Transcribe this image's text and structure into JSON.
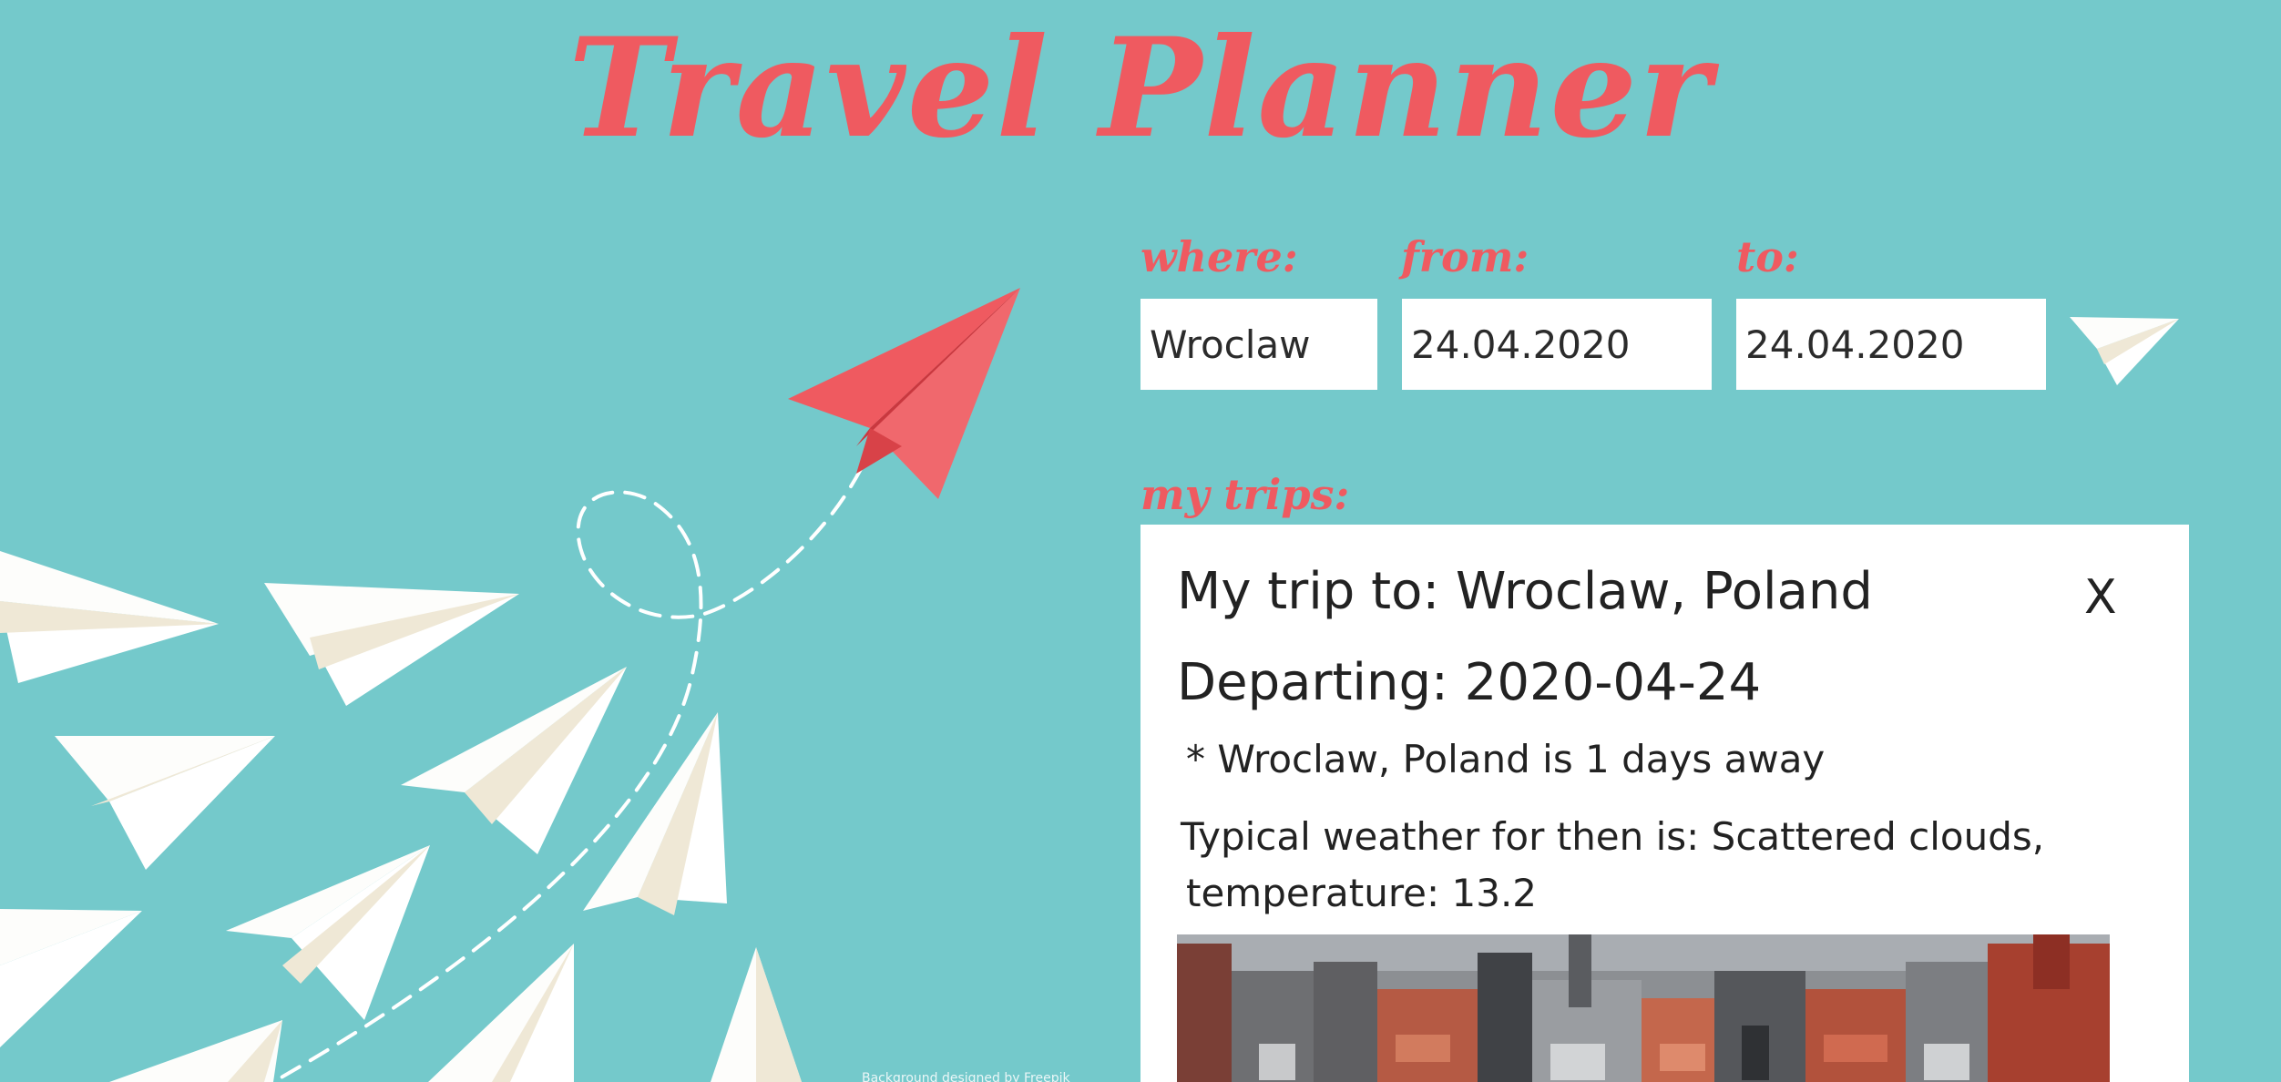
{
  "header": {
    "title": "Travel Planner"
  },
  "form": {
    "where_label": "where:",
    "where_value": "Wroclaw",
    "from_label": "from:",
    "from_value": "24.04.2020",
    "to_label": "to:",
    "to_value": "24.04.2020",
    "submit_icon": "paper-plane-icon"
  },
  "trips": {
    "label": "my trips:",
    "items": [
      {
        "heading": "My trip to: Wroclaw, Poland",
        "close_label": "X",
        "departing": "Departing: 2020-04-24",
        "countdown": "* Wroclaw, Poland is 1 days away",
        "weather_line1": "Typical weather for then is: Scattered clouds,",
        "weather_line2": "temperature: 13.2",
        "photo_icon": "city-photo-icon"
      }
    ]
  },
  "footer": {
    "credit": "Background designed by Freepik"
  },
  "colors": {
    "background": "#74c9cb",
    "accent": "#ef5a60",
    "card": "#ffffff",
    "plane_white": "#fdfdfb",
    "plane_shade": "#efe8d6"
  }
}
